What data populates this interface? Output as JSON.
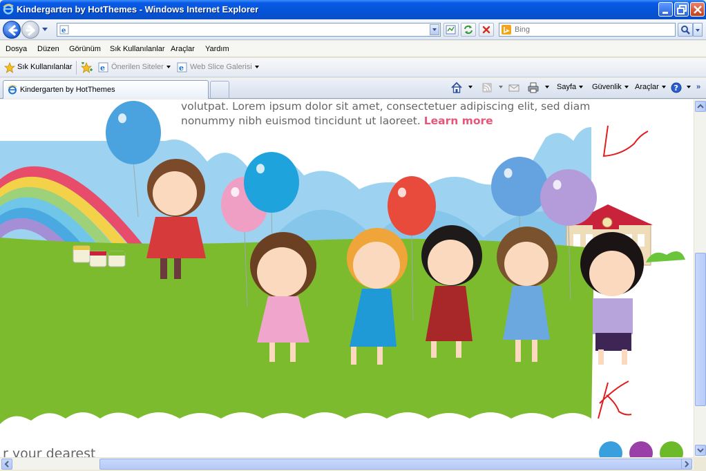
{
  "window": {
    "title": "Kindergarten by HotThemes - Windows Internet Explorer"
  },
  "address_bar": {
    "url": "",
    "search_placeholder": "Bing"
  },
  "menu": [
    "Dosya",
    "Düzen",
    "Görünüm",
    "Sık Kullanılanlar",
    "Araçlar",
    "Yardım"
  ],
  "favorites_bar": {
    "favorites_label": "Sık Kullanılanlar",
    "suggested_sites": "Önerilen Siteler",
    "web_slice_gallery": "Web Slice Galerisi"
  },
  "tabs": [
    {
      "label": "Kindergarten by HotThemes"
    }
  ],
  "command_bar": {
    "page": "Sayfa",
    "safety": "Güvenlik",
    "tools": "Araçlar"
  },
  "page": {
    "hero_line1": "volutpat. Lorem ipsum dolor sit amet, consectetuer adipiscing elit, sed diam",
    "hero_line2": "nonummy nibh euismod tincidunt ut laoreet.",
    "learn_more": "Learn more",
    "bottom_text": "r your dearest"
  },
  "colors": {
    "grass": "#7cba2e",
    "sky": "#9dd3f0",
    "learn_more": "#e4577a",
    "body_text": "#666666",
    "annotation": "#e01c1c"
  },
  "balloons": [
    {
      "color": "#4aa3de",
      "name": "blue"
    },
    {
      "color": "#ef9fc4",
      "name": "pink"
    },
    {
      "color": "#1fa3dc",
      "name": "cyan"
    },
    {
      "color": "#e84a3c",
      "name": "red"
    },
    {
      "color": "#64a3e0",
      "name": "light-blue"
    },
    {
      "color": "#b49cdb",
      "name": "purple"
    }
  ]
}
